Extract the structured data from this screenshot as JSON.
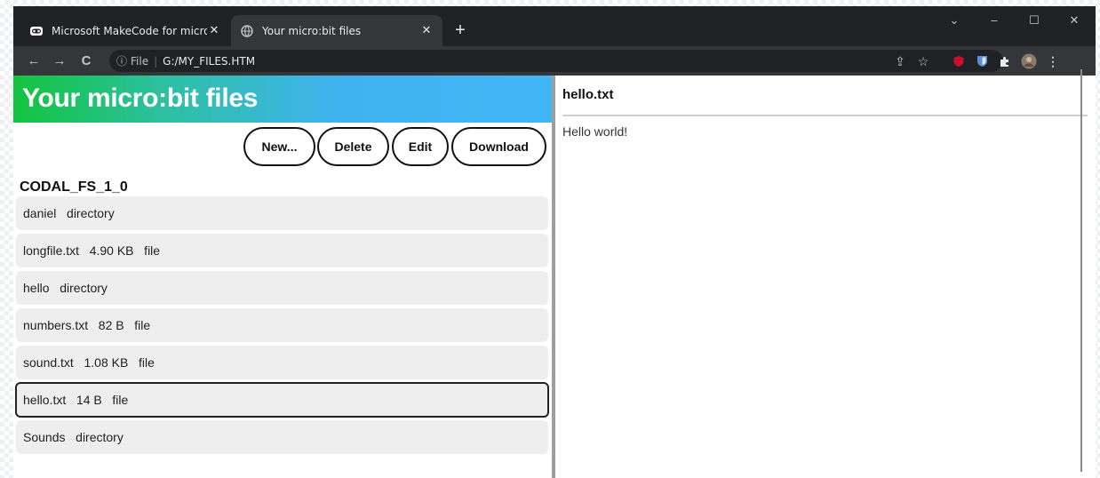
{
  "browser": {
    "tabs": [
      {
        "label": "Microsoft MakeCode for micro:bi",
        "icon": "makecode-icon",
        "active": false
      },
      {
        "label": "Your micro:bit files",
        "icon": "globe-icon",
        "active": true
      }
    ],
    "url_scheme": "File",
    "url": "G:/MY_FILES.HTM"
  },
  "page": {
    "title": "Your micro:bit files",
    "buttons": {
      "new": "New...",
      "delete": "Delete",
      "edit": "Edit",
      "download": "Download"
    },
    "filesystem_name": "CODAL_FS_1_0",
    "files": [
      {
        "text": "daniel   directory",
        "selected": false
      },
      {
        "text": "longfile.txt   4.90 KB   file",
        "selected": false
      },
      {
        "text": "hello   directory",
        "selected": false
      },
      {
        "text": "numbers.txt   82 B   file",
        "selected": false
      },
      {
        "text": "sound.txt   1.08 KB   file",
        "selected": false
      },
      {
        "text": "hello.txt   14 B   file",
        "selected": true
      },
      {
        "text": "Sounds   directory",
        "selected": false
      }
    ],
    "preview": {
      "filename": "hello.txt",
      "content": "Hello world!"
    }
  },
  "colors": {
    "banner_start": "#13c43e",
    "banner_end": "#40b6f7",
    "chrome_dark": "#202124",
    "chrome_toolbar": "#35363a"
  }
}
